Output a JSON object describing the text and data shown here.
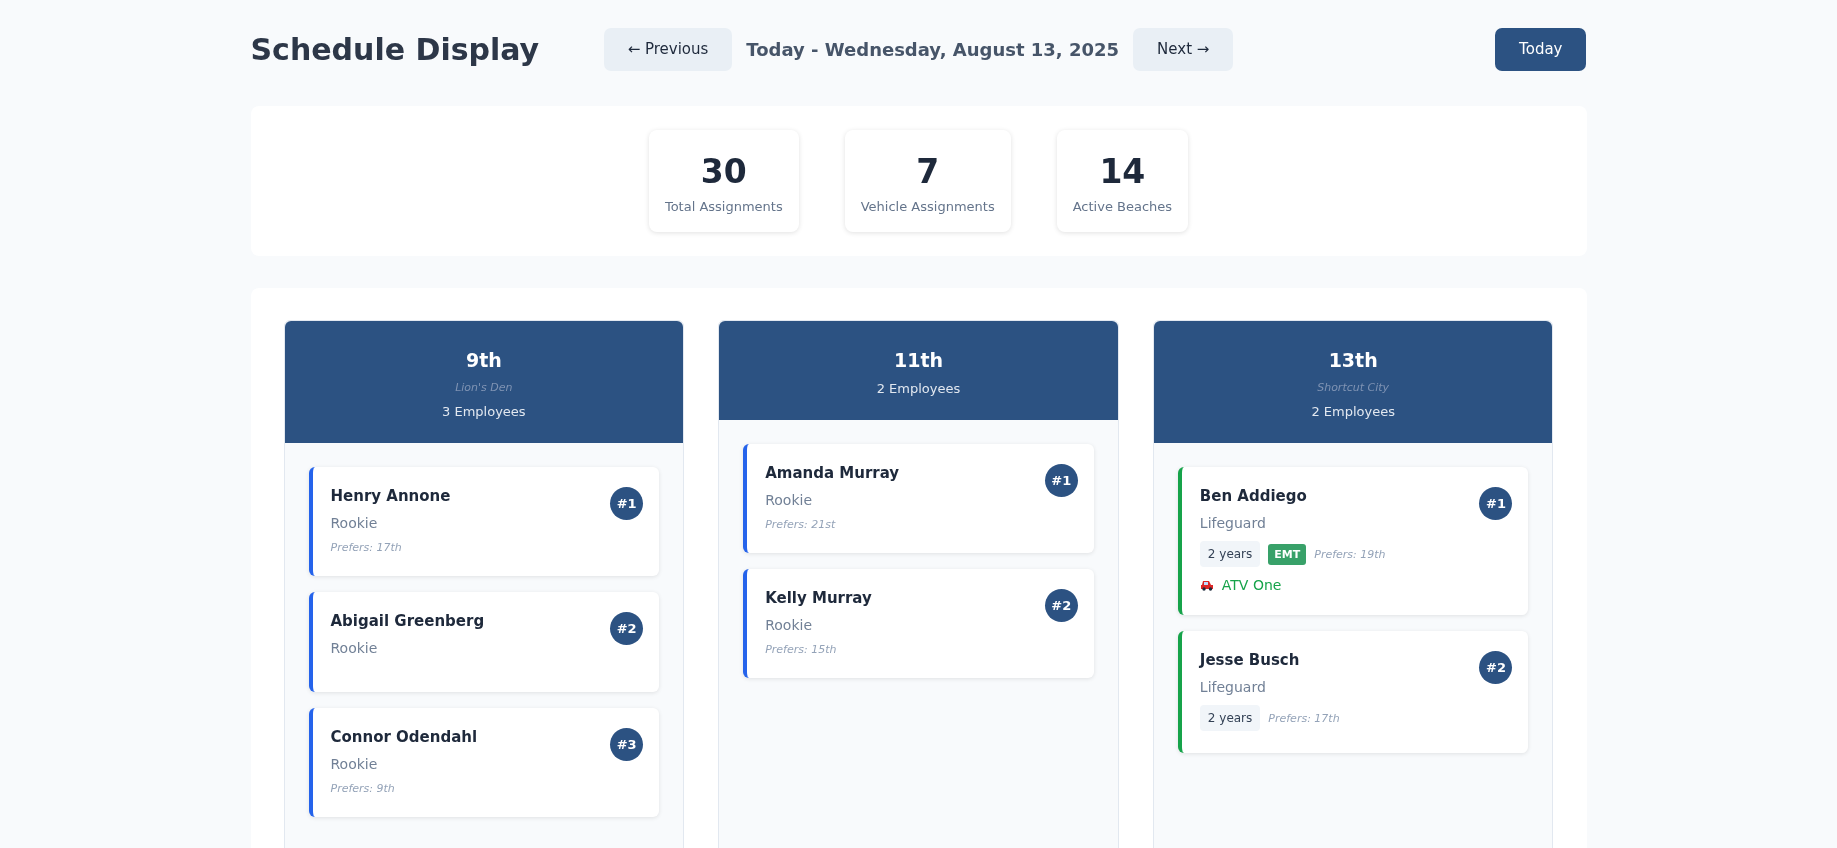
{
  "header": {
    "title": "Schedule Display",
    "prev_button": "← Previous",
    "date": "Today - Wednesday, August 13, 2025",
    "next_button": "Next →",
    "today_button": "Today"
  },
  "stats": [
    {
      "value": "30",
      "label": "Total Assignments"
    },
    {
      "value": "7",
      "label": "Vehicle Assignments"
    },
    {
      "value": "14",
      "label": "Active Beaches"
    }
  ],
  "beaches": [
    {
      "name": "9th",
      "subtitle": "Lion's Den",
      "count": "3 Employees",
      "employees": [
        {
          "name": "Henry Annone",
          "role": "Rookie",
          "color": "#2563eb",
          "rank": "#1",
          "prefers": "Prefers: 17th"
        },
        {
          "name": "Abigail Greenberg",
          "role": "Rookie",
          "color": "#2563eb",
          "rank": "#2"
        },
        {
          "name": "Connor Odendahl",
          "role": "Rookie",
          "color": "#2563eb",
          "rank": "#3",
          "prefers": "Prefers: 9th"
        }
      ]
    },
    {
      "name": "11th",
      "count": "2 Employees",
      "employees": [
        {
          "name": "Amanda Murray",
          "role": "Rookie",
          "color": "#2563eb",
          "rank": "#1",
          "prefers": "Prefers: 21st"
        },
        {
          "name": "Kelly Murray",
          "role": "Rookie",
          "color": "#2563eb",
          "rank": "#2",
          "prefers": "Prefers: 15th"
        }
      ]
    },
    {
      "name": "13th",
      "subtitle": "Shortcut City",
      "count": "2 Employees",
      "employees": [
        {
          "name": "Ben Addiego",
          "role": "Lifeguard",
          "color": "#16a34a",
          "rank": "#1",
          "years": "2 years",
          "cert": "EMT",
          "prefers": "Prefers: 19th",
          "vehicle": "ATV One"
        },
        {
          "name": "Jesse Busch",
          "role": "Lifeguard",
          "color": "#16a34a",
          "rank": "#2",
          "years": "2 years",
          "prefers": "Prefers: 17th"
        }
      ]
    }
  ]
}
